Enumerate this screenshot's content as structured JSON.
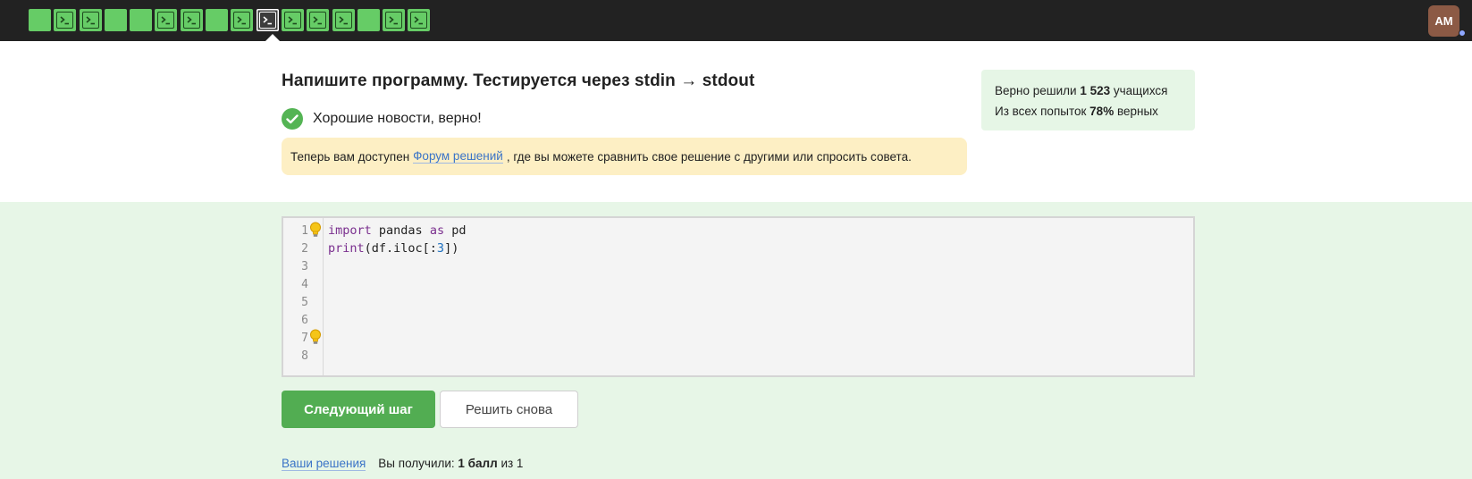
{
  "topbar": {
    "steps": [
      {
        "kind": "plain"
      },
      {
        "kind": "code"
      },
      {
        "kind": "code"
      },
      {
        "kind": "plain"
      },
      {
        "kind": "plain"
      },
      {
        "kind": "code"
      },
      {
        "kind": "code"
      },
      {
        "kind": "plain"
      },
      {
        "kind": "code"
      },
      {
        "kind": "code",
        "active": true
      },
      {
        "kind": "code"
      },
      {
        "kind": "code"
      },
      {
        "kind": "code"
      },
      {
        "kind": "plain"
      },
      {
        "kind": "code"
      },
      {
        "kind": "code"
      }
    ],
    "avatar_initials": "AM"
  },
  "task": {
    "title": "Напишите программу. Тестируется через stdin → stdout",
    "result_message": "Хорошие новости, верно!",
    "notice": {
      "before": "Теперь вам доступен",
      "link": "Форум решений",
      "after": ", где вы можете сравнить свое решение с другими или спросить совета."
    }
  },
  "stats": {
    "line1_prefix": "Верно решили",
    "solved_count": "1 523",
    "line1_suffix": "учащихся",
    "line2_prefix": "Из всех попыток",
    "correct_percent": "78%",
    "line2_suffix": "верных"
  },
  "editor": {
    "line_numbers": [
      "1",
      "2",
      "3",
      "4",
      "5",
      "6",
      "7",
      "8"
    ],
    "code": {
      "l1_kw1": "import",
      "l1_mod": " pandas ",
      "l1_kw2": "as",
      "l1_alias": " pd",
      "l2_fn": "print",
      "l2_a": "(df.iloc[:",
      "l2_num": "3",
      "l2_b": "])"
    }
  },
  "actions": {
    "next_label": "Следующий шаг",
    "retry_label": "Решить снова"
  },
  "footer": {
    "solutions_link": "Ваши решения",
    "score_prefix": "Вы получили:",
    "score_value": "1 балл",
    "score_suffix": "из 1"
  },
  "colors": {
    "topbar_bg": "#222222",
    "step_green": "#66cc66",
    "success_green": "#52ad52",
    "notice_bg": "#fdefc4",
    "section_green": "#e7f6e7",
    "link_blue": "#3b74c7"
  }
}
